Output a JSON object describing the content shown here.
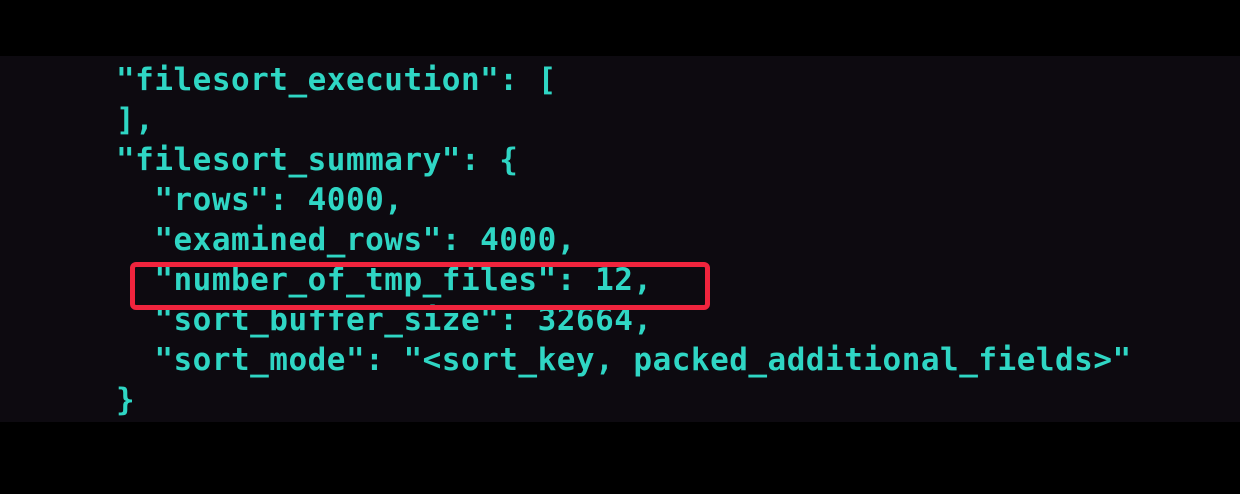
{
  "terminal": {
    "lines": [
      "\"filesort_execution\": [",
      "],",
      "\"filesort_summary\": {",
      "  \"rows\": 4000,",
      "  \"examined_rows\": 4000,",
      "  \"number_of_tmp_files\": 12,",
      "  \"sort_buffer_size\": 32664,",
      "  \"sort_mode\": \"<sort_key, packed_additional_fields>\"",
      "}"
    ]
  },
  "colors": {
    "text": "#2fd6c4",
    "background": "#0d0a10",
    "highlight": "#f0243d"
  }
}
